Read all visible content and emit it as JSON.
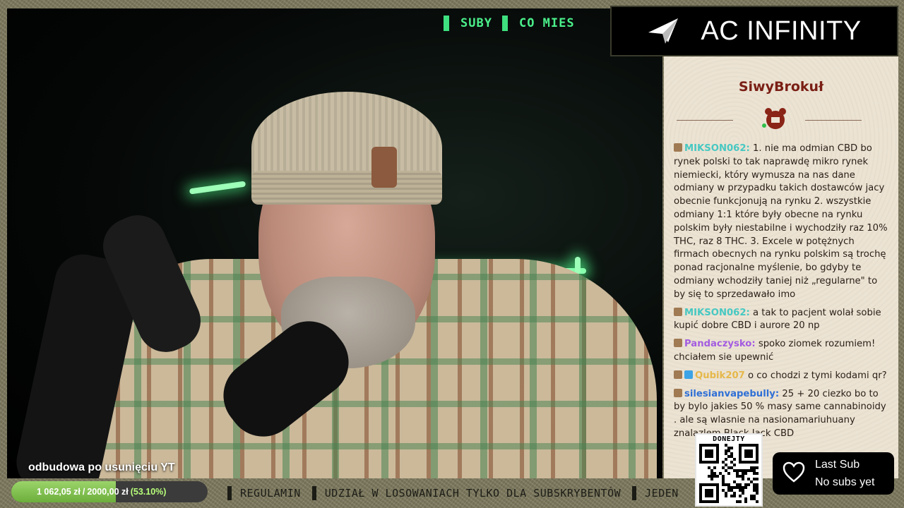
{
  "top_ticker": {
    "items": [
      "SUBY",
      "CO MIES"
    ]
  },
  "sponsor": {
    "name": "AC INFINITY",
    "icon": "paper-plane-icon"
  },
  "chat": {
    "channel": "SiwyBrokuł",
    "messages": [
      {
        "user": "MIKSON062:",
        "user_color": "#47c8c2",
        "badges": [
          "sub-badge"
        ],
        "text": " 1. nie ma odmian CBD bo rynek polski to tak naprawdę mikro rynek niemiecki, który wymusza na nas dane odmiany w przypadku takich dostawców jacy obecnie funkcjonują na rynku 2. wszystkie odmiany 1:1 które były obecne na rynku polskim były niestabilne i wychodziły raz 10% THC, raz 8 THC. 3. Excele w potężnych firmach obecnych na rynku polskim są trochę ponad racjonalne myślenie, bo gdyby te odmiany wchodziły taniej niż „regularne\" to by się to sprzedawało imo"
      },
      {
        "user": "MIKSON062:",
        "user_color": "#47c8c2",
        "badges": [
          "sub-badge"
        ],
        "text": " a tak to pacjent wolał sobie kupić dobre CBD i aurore 20 np"
      },
      {
        "user": "Pandaczysko:",
        "user_color": "#a35ce0",
        "badges": [
          "sub-badge"
        ],
        "text": " spoko ziomek rozumiem! chciałem sie upewnić"
      },
      {
        "user": "Qubik207",
        "user_color": "#e6b84a",
        "badges": [
          "sub-badge",
          "cube-badge"
        ],
        "text": " o co chodzi z tymi kodami qr?"
      },
      {
        "user": "silesianvapebully:",
        "user_color": "#2f6fd6",
        "badges": [
          "sub-badge"
        ],
        "text": " 25 + 20 ciezko bo to by bylo jakies 50 % masy same cannabinoidy . ale są wlasnie na nasionamariuhuany znalazlem Black Jack CBD"
      }
    ]
  },
  "goal": {
    "label": "odbudowa po usunięciu YT",
    "current": "1 062,05 zł",
    "separator": "/",
    "target": "2000,00 zł",
    "percent": "(53.10%)",
    "fraction": 0.531
  },
  "bottom_ticker": {
    "items": [
      "REGULAMIN",
      "UDZIAŁ W LOSOWANIACH TYLKO DLA SUBSKRYBENTÓW",
      "JEDEN"
    ]
  },
  "qr": {
    "label": "DONEJTY"
  },
  "last_sub": {
    "title": "Last Sub",
    "value": "No subs yet",
    "icon": "heart-icon"
  }
}
